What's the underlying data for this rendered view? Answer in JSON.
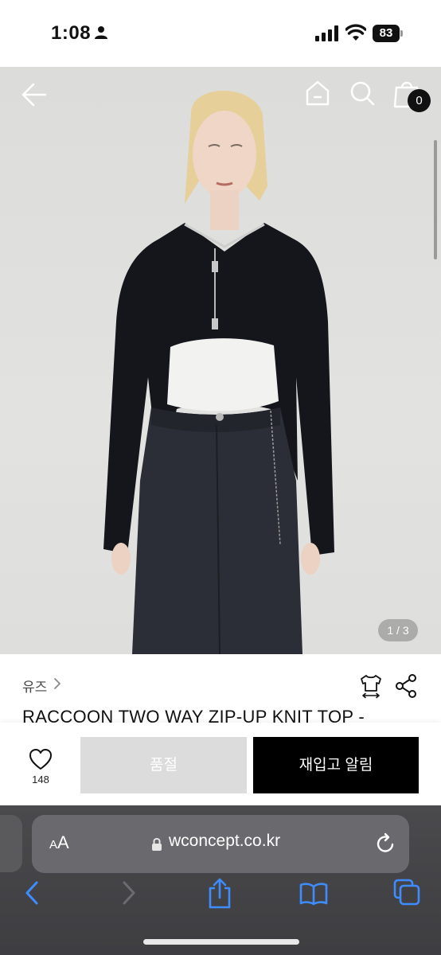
{
  "status_bar": {
    "time": "1:08",
    "battery": "83"
  },
  "product": {
    "brand": "유즈",
    "title": "RACCOON TWO WAY ZIP-UP KNIT TOP -",
    "image_counter": "1 / 3",
    "cart_count": "0"
  },
  "purchase": {
    "like_count": "148",
    "soldout_label": "품절",
    "restock_label": "재입고 알림"
  },
  "browser": {
    "aa_small": "A",
    "aa_large": "A",
    "url": "wconcept.co.kr"
  },
  "colors": {
    "accent": "#000000",
    "soldout_bg": "#dcdcdc",
    "safari_bg": "#414144",
    "link_blue": "#3f8cff"
  },
  "icons": [
    "person-icon",
    "signal-icon",
    "wifi-icon",
    "battery-icon",
    "back-arrow-icon",
    "home-icon",
    "search-icon",
    "shopping-bag-icon",
    "chevron-right-icon",
    "size-guide-icon",
    "share-icon",
    "heart-icon",
    "lock-icon",
    "reload-icon",
    "back-chevron-icon",
    "forward-chevron-icon",
    "share-box-icon",
    "bookmarks-icon",
    "tabs-icon"
  ]
}
